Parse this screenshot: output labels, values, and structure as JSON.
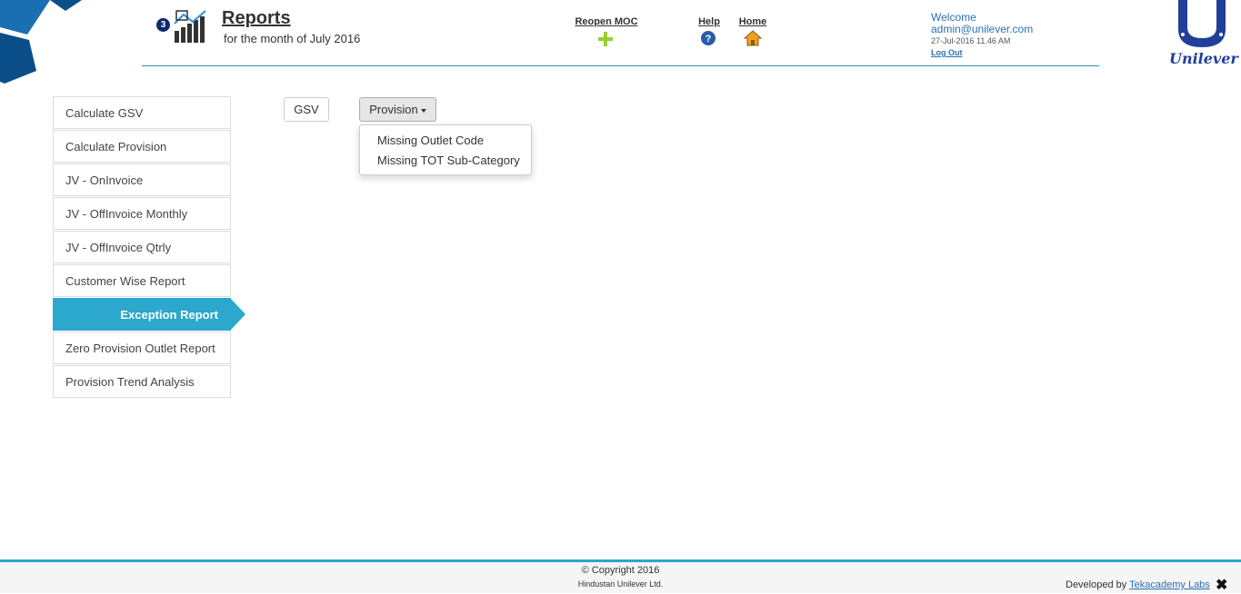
{
  "header": {
    "badge_count": "3",
    "title": "Reports",
    "subtitle": "for the month of July 2016",
    "nav": {
      "reopen_label": "Reopen MOC",
      "help_label": "Help",
      "home_label": "Home"
    },
    "user": {
      "welcome": "Welcome",
      "email": "admin@unilever.com",
      "datetime": "27-Jul-2016 11.46 AM",
      "logout": "Log Out"
    },
    "logo_text": "Unilever"
  },
  "sidebar": {
    "items": [
      {
        "label": "Calculate GSV",
        "active": false
      },
      {
        "label": "Calculate Provision",
        "active": false
      },
      {
        "label": "JV - OnInvoice",
        "active": false
      },
      {
        "label": "JV - OffInvoice Monthly",
        "active": false
      },
      {
        "label": "JV - OffInvoice Qtrly",
        "active": false
      },
      {
        "label": "Customer Wise Report",
        "active": false
      },
      {
        "label": "Exception Report",
        "active": true
      },
      {
        "label": "Zero Provision Outlet Report",
        "active": false
      },
      {
        "label": "Provision Trend Analysis",
        "active": false
      }
    ]
  },
  "toolbar": {
    "gsv_label": "GSV",
    "provision_label": "Provision",
    "dropdown_items": [
      "Missing Outlet Code",
      "Missing TOT Sub-Category"
    ]
  },
  "footer": {
    "copyright": "Copyright 2016",
    "company": "Hindustan Unilever Ltd.",
    "developed_by": "Developed by",
    "developer": "Tekacademy Labs"
  },
  "colors": {
    "accent": "#2ba8cb",
    "link": "#2a6fb5",
    "badge": "#0d2a6e",
    "logo": "#1f3f99",
    "plus": "#9acd32"
  },
  "icons": [
    "chart-icon",
    "plus-icon",
    "help-icon",
    "home-icon",
    "unilever-logo",
    "close-icon",
    "copyright-icon"
  ]
}
